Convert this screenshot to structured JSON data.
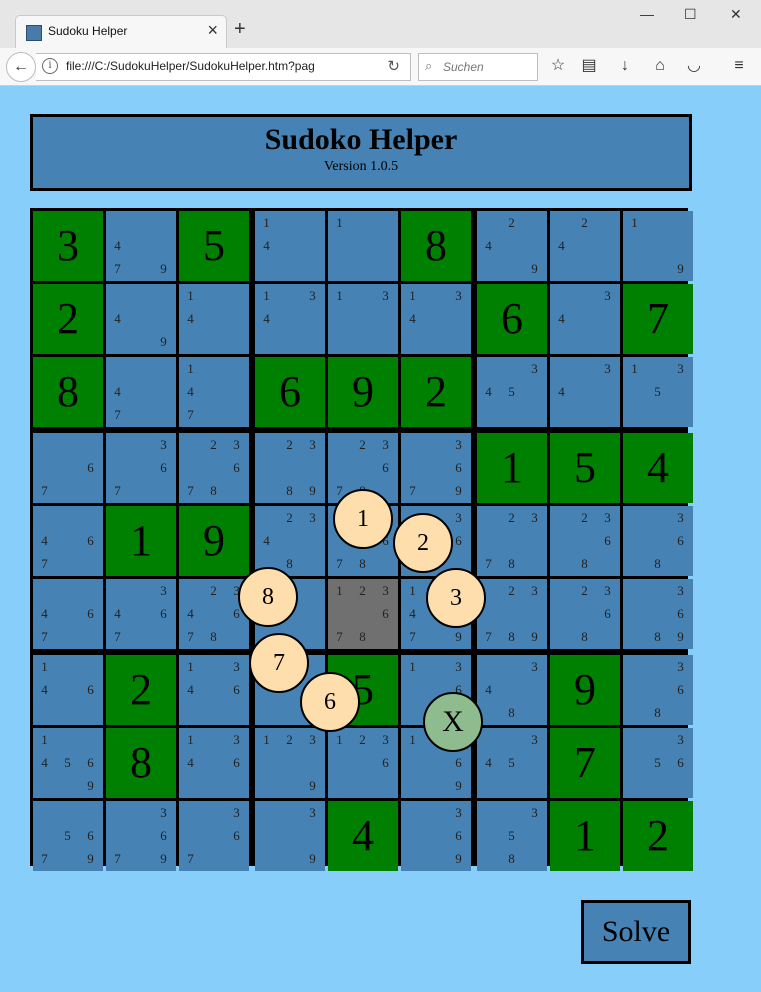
{
  "browser": {
    "tab_title": "Sudoku Helper",
    "url": "file:///C:/SudokuHelper/SudokuHelper.htm?pag",
    "search_placeholder": "Suchen"
  },
  "header": {
    "title": "Sudoko Helper",
    "version": "Version 1.0.5"
  },
  "colors": {
    "given": "#008000",
    "empty": "#4682b4",
    "selected": "#707070",
    "highlight": "#90ee90",
    "background": "#87cefa"
  },
  "selected_cell": [
    5,
    4
  ],
  "givens": [
    [
      "3",
      "",
      "5",
      "",
      "",
      "8",
      "",
      "",
      ""
    ],
    [
      "2",
      "",
      "",
      "",
      "",
      "",
      "6",
      "",
      "7"
    ],
    [
      "8",
      "",
      "",
      "6",
      "9",
      "2",
      "",
      "",
      ""
    ],
    [
      "",
      "",
      "",
      "",
      "",
      "",
      "1",
      "5",
      "4"
    ],
    [
      "",
      "1",
      "9",
      "",
      "",
      "",
      "",
      "",
      ""
    ],
    [
      "",
      "",
      "",
      "",
      "",
      "",
      "",
      "",
      ""
    ],
    [
      "",
      "2",
      "",
      "",
      "5",
      "",
      "",
      "9",
      ""
    ],
    [
      "",
      "8",
      "",
      "",
      "",
      "",
      "",
      "7",
      ""
    ],
    [
      "",
      "",
      "",
      "",
      "4",
      "",
      "",
      "1",
      "2"
    ]
  ],
  "candidates": [
    [
      [],
      [
        4,
        7,
        9
      ],
      [],
      [
        1,
        4
      ],
      [
        1
      ],
      [],
      [
        2,
        4,
        9
      ],
      [
        2,
        4
      ],
      [
        1,
        9
      ]
    ],
    [
      [],
      [
        4,
        9
      ],
      [
        1,
        4
      ],
      [
        1,
        3,
        4
      ],
      [
        1,
        3
      ],
      [
        1,
        3,
        4
      ],
      [],
      [
        3,
        4
      ],
      []
    ],
    [
      [],
      [
        4,
        7
      ],
      [
        1,
        4,
        7
      ],
      [],
      [],
      [],
      [
        3,
        4,
        5
      ],
      [
        3,
        4
      ],
      [
        1,
        3,
        5
      ]
    ],
    [
      [
        6,
        7
      ],
      [
        3,
        6,
        7
      ],
      [
        2,
        3,
        6,
        7,
        8
      ],
      [
        2,
        3,
        8,
        9
      ],
      [
        2,
        3,
        6,
        7,
        8
      ],
      [
        3,
        6,
        7,
        9
      ],
      [],
      [],
      []
    ],
    [
      [
        4,
        6,
        7
      ],
      [],
      [],
      [
        2,
        3,
        4,
        8
      ],
      [
        2,
        3,
        6,
        7,
        8
      ],
      [
        3,
        6
      ],
      [
        2,
        3,
        7,
        8
      ],
      [
        2,
        3,
        6,
        8
      ],
      [
        3,
        6,
        8
      ]
    ],
    [
      [
        4,
        6,
        7
      ],
      [
        3,
        4,
        6,
        7
      ],
      [
        2,
        3,
        4,
        6,
        7,
        8
      ],
      [],
      [
        1,
        2,
        3,
        6,
        7,
        8
      ],
      [
        1,
        3,
        4,
        7,
        9
      ],
      [
        2,
        3,
        7,
        8,
        9
      ],
      [
        2,
        3,
        6,
        8
      ],
      [
        3,
        6,
        8,
        9
      ]
    ],
    [
      [
        1,
        4,
        6
      ],
      [],
      [
        1,
        3,
        4,
        6
      ],
      [],
      [],
      [
        1,
        3,
        6
      ],
      [
        3,
        4,
        8
      ],
      [],
      [
        3,
        6,
        8
      ]
    ],
    [
      [
        1,
        4,
        5,
        6,
        9
      ],
      [],
      [
        1,
        3,
        4,
        6
      ],
      [
        1,
        2,
        3,
        9
      ],
      [
        1,
        2,
        3,
        6
      ],
      [
        1,
        3,
        6,
        9
      ],
      [
        3,
        4,
        5
      ],
      [],
      [
        3,
        5,
        6
      ]
    ],
    [
      [
        5,
        6,
        7,
        9
      ],
      [
        3,
        6,
        7,
        9
      ],
      [
        3,
        6,
        7
      ],
      [
        3,
        9
      ],
      [],
      [
        3,
        6,
        9
      ],
      [
        3,
        5,
        8
      ],
      [],
      []
    ]
  ],
  "highlights": [
    [
      [
        0,
        1,
        6
      ]
    ],
    [
      [
        0,
        4,
        7
      ]
    ],
    [
      [
        1,
        5,
        5
      ]
    ],
    [
      [
        1,
        7,
        8
      ]
    ],
    [
      [
        4,
        0,
        5
      ]
    ],
    [
      [
        8,
        1,
        5
      ]
    ],
    [
      [
        8,
        3,
        8
      ]
    ]
  ],
  "wheel": {
    "items": [
      {
        "label": "1",
        "name": "wheel-option-1"
      },
      {
        "label": "2",
        "name": "wheel-option-2"
      },
      {
        "label": "3",
        "name": "wheel-option-3"
      },
      {
        "label": "6",
        "name": "wheel-option-6"
      },
      {
        "label": "7",
        "name": "wheel-option-7"
      },
      {
        "label": "8",
        "name": "wheel-option-8"
      },
      {
        "label": "X",
        "name": "wheel-clear"
      }
    ]
  },
  "solve_label": "Solve"
}
